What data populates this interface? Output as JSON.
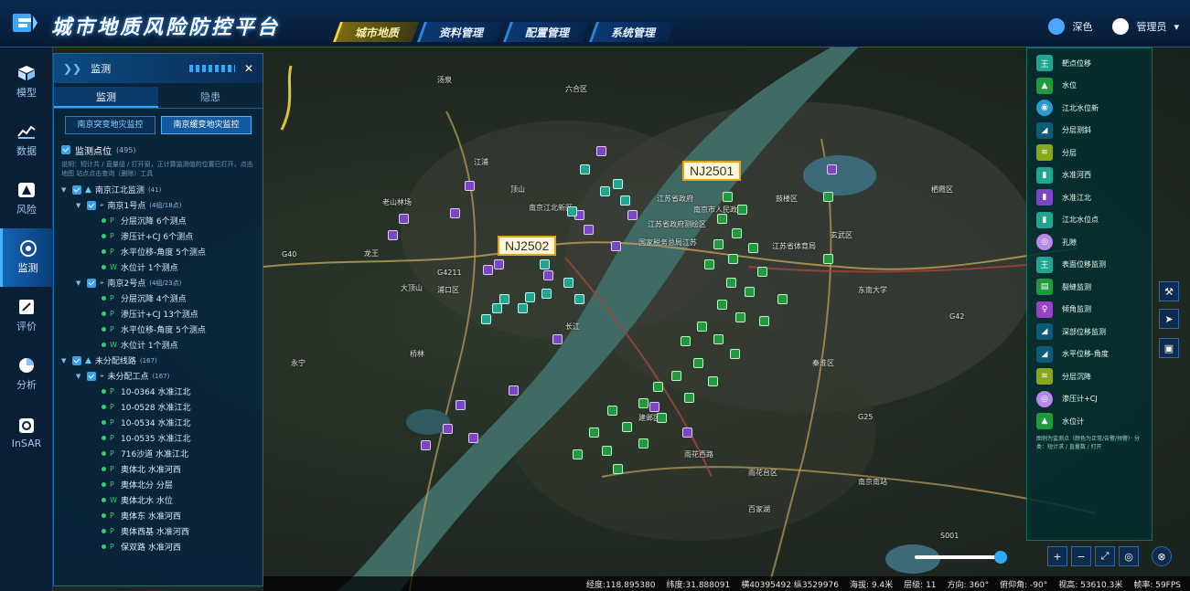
{
  "header": {
    "title": "城市地质风险防控平台",
    "tabs": [
      {
        "label": "城市地质",
        "active": true
      },
      {
        "label": "资料管理",
        "active": false
      },
      {
        "label": "配置管理",
        "active": false
      },
      {
        "label": "系统管理",
        "active": false
      }
    ],
    "theme_label": "深色",
    "user_label": "管理员",
    "accent": "#2fa8ff"
  },
  "nav": [
    {
      "label": "模型",
      "icon": "cube-icon"
    },
    {
      "label": "数据",
      "icon": "chart-icon"
    },
    {
      "label": "风险",
      "icon": "warning-icon"
    },
    {
      "label": "监测",
      "icon": "monitor-icon",
      "active": true
    },
    {
      "label": "评价",
      "icon": "edit-icon"
    },
    {
      "label": "分析",
      "icon": "pie-icon"
    },
    {
      "label": "InSAR",
      "icon": "insar-icon"
    }
  ],
  "panel": {
    "title": "监测",
    "subtabs": [
      "监测",
      "隐患"
    ],
    "buttons": [
      "南京突变地灾监控",
      "南京缓变地灾监控"
    ],
    "section_title": "监测点位",
    "section_count": "(495)",
    "hint": "说明：短计共 / 直量组 / 打开窗，正计算监测值的位置已打开，点击地图 站点点击查询（删除）工具",
    "tree": [
      {
        "level": 0,
        "label": "南京江北监测",
        "count": "(41)",
        "kind": "group"
      },
      {
        "level": 1,
        "label": "南京1号点",
        "count": "(4组/18点)",
        "kind": "site"
      },
      {
        "level": 2,
        "tag": "P",
        "label": "分层沉降 6个测点"
      },
      {
        "level": 2,
        "tag": "P",
        "label": "渗压计+CJ 6个测点"
      },
      {
        "level": 2,
        "tag": "P",
        "label": "水平位移-角度 5个测点"
      },
      {
        "level": 2,
        "tag": "W",
        "label": "水位计 1个测点"
      },
      {
        "level": 1,
        "label": "南京2号点",
        "count": "(4组/23点)",
        "kind": "site"
      },
      {
        "level": 2,
        "tag": "P",
        "label": "分层沉降 4个测点"
      },
      {
        "level": 2,
        "tag": "P",
        "label": "渗压计+CJ 13个测点"
      },
      {
        "level": 2,
        "tag": "P",
        "label": "水平位移-角度 5个测点"
      },
      {
        "level": 2,
        "tag": "W",
        "label": "水位计 1个测点"
      },
      {
        "level": 0,
        "label": "未分配线路",
        "count": "(167)",
        "kind": "group"
      },
      {
        "level": 1,
        "label": "未分配工点",
        "count": "(167)",
        "kind": "site"
      },
      {
        "level": 2,
        "tag": "P",
        "label": "10-0364 水准江北"
      },
      {
        "level": 2,
        "tag": "P",
        "label": "10-0528 水准江北"
      },
      {
        "level": 2,
        "tag": "P",
        "label": "10-0534 水准江北"
      },
      {
        "level": 2,
        "tag": "P",
        "label": "10-0535 水准江北"
      },
      {
        "level": 2,
        "tag": "P",
        "label": "716沙道 水准江北"
      },
      {
        "level": 2,
        "tag": "P",
        "label": "奥体北 水准河西"
      },
      {
        "level": 2,
        "tag": "P",
        "label": "奥体北分 分层"
      },
      {
        "level": 2,
        "tag": "W",
        "label": "奥体北水 水位"
      },
      {
        "level": 2,
        "tag": "P",
        "label": "奥体东 水准河西"
      },
      {
        "level": 2,
        "tag": "P",
        "label": "奥体西基 水准河西"
      },
      {
        "level": 2,
        "tag": "P",
        "label": "保双路 水准河西"
      }
    ]
  },
  "legend": {
    "items": [
      {
        "label": "靶点位移",
        "color": "#1fa690",
        "icon": "target-icon"
      },
      {
        "label": "水位",
        "color": "#1f9a3c",
        "icon": "water-level-icon"
      },
      {
        "label": "江北水位新",
        "color": "#2a9ad0",
        "icon": "water-new-icon"
      },
      {
        "label": "分层测斜",
        "color": "#0e5a7a",
        "icon": "inclinometer-icon"
      },
      {
        "label": "分层",
        "color": "#8aa81c",
        "icon": "layer-icon"
      },
      {
        "label": "水准河西",
        "color": "#1fa690",
        "icon": "level-hexi-icon"
      },
      {
        "label": "水准江北",
        "color": "#7b45c9",
        "icon": "level-jiangbei-icon"
      },
      {
        "label": "江北水位点",
        "color": "#1fa690",
        "icon": "water-point-icon"
      },
      {
        "label": "孔隙",
        "color": "#b58ae8",
        "icon": "pore-icon"
      },
      {
        "label": "表面位移监测",
        "color": "#1fa690",
        "icon": "surface-icon"
      },
      {
        "label": "裂缝监测",
        "color": "#1f9a3c",
        "icon": "crack-icon"
      },
      {
        "label": "倾角监测",
        "color": "#9a3fc9",
        "icon": "tilt-icon"
      },
      {
        "label": "深部位移监测",
        "color": "#0e5a7a",
        "icon": "deep-icon"
      },
      {
        "label": "水平位移-角度",
        "color": "#0e5a7a",
        "icon": "horizontal-icon"
      },
      {
        "label": "分层沉降",
        "color": "#8aa81c",
        "icon": "settle-icon"
      },
      {
        "label": "渗压计+CJ",
        "color": "#b58ae8",
        "icon": "osmometer-icon"
      },
      {
        "label": "水位计",
        "color": "#1f9a3c",
        "icon": "gauge-icon"
      }
    ],
    "footnote": "图例为监测点（颜色为正常/告警/预警）· 分类：短计求 / 直量数 / 打开"
  },
  "callouts": [
    "NJ2501",
    "NJ2502"
  ],
  "map_labels": [
    "南京市人民政府",
    "江苏省政府",
    "江苏省政府测绘区",
    "国家税务总局江苏",
    "江苏省体育局",
    "东南大学",
    "南京江北新区",
    "浦口区",
    "鼓楼区",
    "玄武区",
    "秦淮区",
    "建邺区",
    "雨花台区",
    "龙王",
    "大顶山",
    "老山林场",
    "桥林",
    "长江",
    "汤泉",
    "江浦",
    "永宁",
    "顶山",
    "六合区",
    "百家湖",
    "栖霞区",
    "南京南站",
    "雨花西路",
    "G42",
    "G40",
    "G25",
    "S001",
    "G4211"
  ],
  "zoom": {
    "level": 0.9
  },
  "status": {
    "lon": "经度:118.895380",
    "lat": "纬度:31.888091",
    "proj": "横40395492 纵3529976",
    "altitude": "海拔: 9.4米",
    "layer": "层级: 11",
    "heading": "方向: 360°",
    "pitch": "俯仰角: -90°",
    "view_height": "视高: 53610.3米",
    "fps": "帧率: 59FPS"
  }
}
